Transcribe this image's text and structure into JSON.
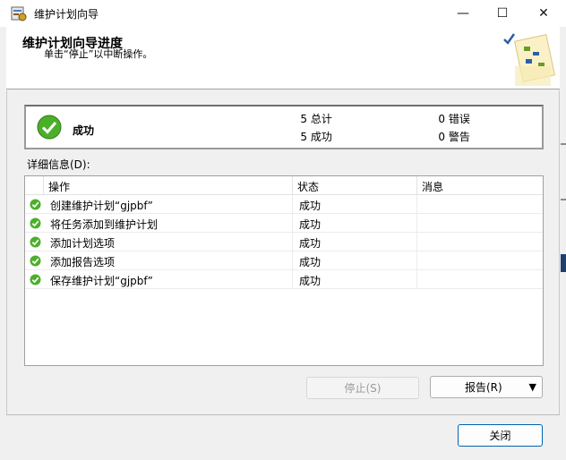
{
  "window": {
    "title": "维护计划向导",
    "min_glyph": "—",
    "max_glyph": "☐",
    "close_glyph": "✕"
  },
  "header": {
    "title": "维护计划向导进度",
    "subtitle": "单击“停止”以中断操作。"
  },
  "summary": {
    "status": "成功",
    "total_count": "5",
    "total_label": "总计",
    "success_count": "5",
    "success_label": "成功",
    "error_count": "0",
    "error_label": "错误",
    "warning_count": "0",
    "warning_label": "警告"
  },
  "details": {
    "label": "详细信息(D):",
    "columns": [
      "操作",
      "状态",
      "消息"
    ],
    "rows": [
      {
        "action": "创建维护计划“gjpbf”",
        "status": "成功",
        "message": ""
      },
      {
        "action": "将任务添加到维护计划",
        "status": "成功",
        "message": ""
      },
      {
        "action": "添加计划选项",
        "status": "成功",
        "message": ""
      },
      {
        "action": "添加报告选项",
        "status": "成功",
        "message": ""
      },
      {
        "action": "保存维护计划“gjpbf”",
        "status": "成功",
        "message": ""
      }
    ]
  },
  "buttons": {
    "stop": "停止(S)",
    "report": "报告(R)",
    "report_arrow": "▼",
    "close": "关闭"
  },
  "colors": {
    "success_green": "#4caf2a",
    "accent_blue": "#0063b1"
  }
}
